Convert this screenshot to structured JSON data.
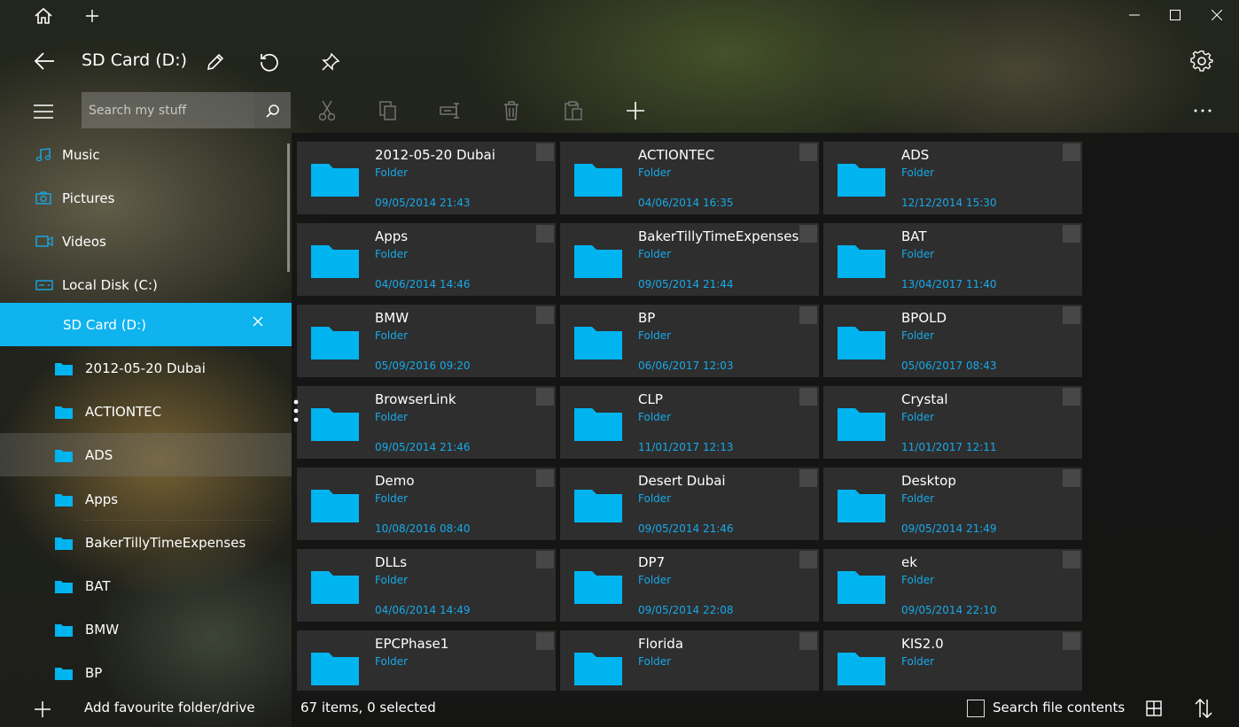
{
  "window": {
    "title": "SD Card (D:)",
    "controls": [
      "minimize",
      "maximize",
      "close"
    ]
  },
  "search": {
    "placeholder": "Search my stuff"
  },
  "sidebar": {
    "items": [
      {
        "label": "Music",
        "icon": "music-icon"
      },
      {
        "label": "Pictures",
        "icon": "camera-icon"
      },
      {
        "label": "Videos",
        "icon": "video-icon"
      },
      {
        "label": "Local Disk (C:)",
        "icon": "drive-icon"
      },
      {
        "label": "SD Card (D:)",
        "icon": "none",
        "active": true
      },
      {
        "label": "2012-05-20 Dubai",
        "icon": "folder-icon"
      },
      {
        "label": "ACTIONTEC",
        "icon": "folder-icon"
      },
      {
        "label": "ADS",
        "icon": "folder-icon",
        "hover": true
      },
      {
        "label": "Apps",
        "icon": "folder-icon"
      },
      {
        "label": "BakerTillyTimeExpenses",
        "icon": "folder-icon"
      },
      {
        "label": "BAT",
        "icon": "folder-icon"
      },
      {
        "label": "BMW",
        "icon": "folder-icon"
      },
      {
        "label": "BP",
        "icon": "folder-icon"
      }
    ],
    "add_favourite": "Add favourite folder/drive"
  },
  "files": [
    {
      "name": "2012-05-20 Dubai",
      "type": "Folder",
      "date": "09/05/2014 21:43"
    },
    {
      "name": "ACTIONTEC",
      "type": "Folder",
      "date": "04/06/2014 16:35"
    },
    {
      "name": "ADS",
      "type": "Folder",
      "date": "12/12/2014 15:30"
    },
    {
      "name": "Apps",
      "type": "Folder",
      "date": "04/06/2014 14:46"
    },
    {
      "name": "BakerTillyTimeExpenses",
      "type": "Folder",
      "date": "09/05/2014 21:44"
    },
    {
      "name": "BAT",
      "type": "Folder",
      "date": "13/04/2017 11:40"
    },
    {
      "name": "BMW",
      "type": "Folder",
      "date": "05/09/2016 09:20"
    },
    {
      "name": "BP",
      "type": "Folder",
      "date": "06/06/2017 12:03"
    },
    {
      "name": "BPOLD",
      "type": "Folder",
      "date": "05/06/2017 08:43"
    },
    {
      "name": "BrowserLink",
      "type": "Folder",
      "date": "09/05/2014 21:46"
    },
    {
      "name": "CLP",
      "type": "Folder",
      "date": "11/01/2017 12:13"
    },
    {
      "name": "Crystal",
      "type": "Folder",
      "date": "11/01/2017 12:11"
    },
    {
      "name": "Demo",
      "type": "Folder",
      "date": "10/08/2016 08:40"
    },
    {
      "name": "Desert Dubai",
      "type": "Folder",
      "date": "09/05/2014 21:46"
    },
    {
      "name": "Desktop",
      "type": "Folder",
      "date": "09/05/2014 21:49"
    },
    {
      "name": "DLLs",
      "type": "Folder",
      "date": "04/06/2014 14:49"
    },
    {
      "name": "DP7",
      "type": "Folder",
      "date": "09/05/2014 22:08"
    },
    {
      "name": "ek",
      "type": "Folder",
      "date": "09/05/2014 22:10"
    },
    {
      "name": "EPCPhase1",
      "type": "Folder",
      "date": ""
    },
    {
      "name": "Florida",
      "type": "Folder",
      "date": ""
    },
    {
      "name": "KIS2.0",
      "type": "Folder",
      "date": ""
    }
  ],
  "status": {
    "summary": "67 items, 0 selected",
    "search_contents_label": "Search file contents"
  },
  "colors": {
    "accent": "#0fb3ee",
    "folder": "#00b4f0",
    "meta_text": "#17a9e8",
    "tile_bg": "#2e2e2e"
  }
}
